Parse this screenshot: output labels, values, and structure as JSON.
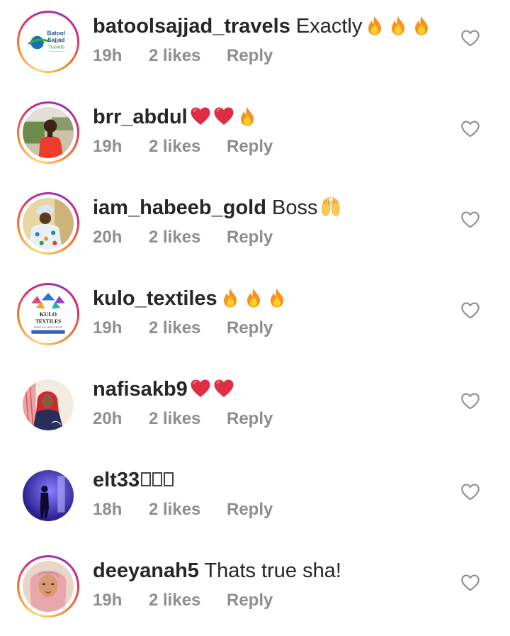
{
  "comments": [
    {
      "username": "batoolsajjad_travels",
      "text": "Exactly",
      "emojis": [
        "fire-emoji",
        "fire-emoji",
        "fire-emoji"
      ],
      "time": "19h",
      "likes": "2 likes",
      "reply": "Reply",
      "avatar": "batool-sajjad-logo",
      "avatar_text": [
        "Batool",
        "Sajjad",
        "Travels"
      ],
      "story_ring": true
    },
    {
      "username": "brr_abdul",
      "text": "",
      "emojis": [
        "red-heart-emoji",
        "red-heart-emoji",
        "fire-emoji"
      ],
      "time": "19h",
      "likes": "2 likes",
      "reply": "Reply",
      "avatar": "person-red-shirt-photo",
      "story_ring": true
    },
    {
      "username": "iam_habeeb_gold",
      "text": "Boss",
      "emojis": [
        "raising-hands-emoji"
      ],
      "time": "20h",
      "likes": "2 likes",
      "reply": "Reply",
      "avatar": "person-patterned-shirt-photo",
      "story_ring": true
    },
    {
      "username": "kulo_textiles",
      "text": "",
      "emojis": [
        "fire-emoji",
        "fire-emoji",
        "fire-emoji"
      ],
      "time": "19h",
      "likes": "2 likes",
      "reply": "Reply",
      "avatar": "kulo-textiles-logo",
      "avatar_text": [
        "KULO",
        "TEXTILES",
        "DEALERS IN ALL KINDS OF TEXTILES"
      ],
      "story_ring": true
    },
    {
      "username": "nafisakb9",
      "text": "",
      "emojis": [
        "red-heart-emoji",
        "red-heart-emoji"
      ],
      "time": "20h",
      "likes": "2 likes",
      "reply": "Reply",
      "avatar": "person-red-hijab-photo",
      "story_ring": false
    },
    {
      "username": "elt33",
      "text": "",
      "emojis": [
        "missing-glyph",
        "missing-glyph",
        "missing-glyph"
      ],
      "time": "18h",
      "likes": "2 likes",
      "reply": "Reply",
      "avatar": "silhouette-purple-light-photo",
      "story_ring": false
    },
    {
      "username": "deeyanah5",
      "text": "Thats true sha!",
      "emojis": [],
      "time": "19h",
      "likes": "2 likes",
      "reply": "Reply",
      "avatar": "person-pink-hijab-photo",
      "story_ring": true
    }
  ],
  "icons": {
    "like": "heart-outline-icon"
  },
  "colors": {
    "text": "#262626",
    "meta": "#8e8e8e",
    "heart_outline": "#8e8e8e"
  }
}
